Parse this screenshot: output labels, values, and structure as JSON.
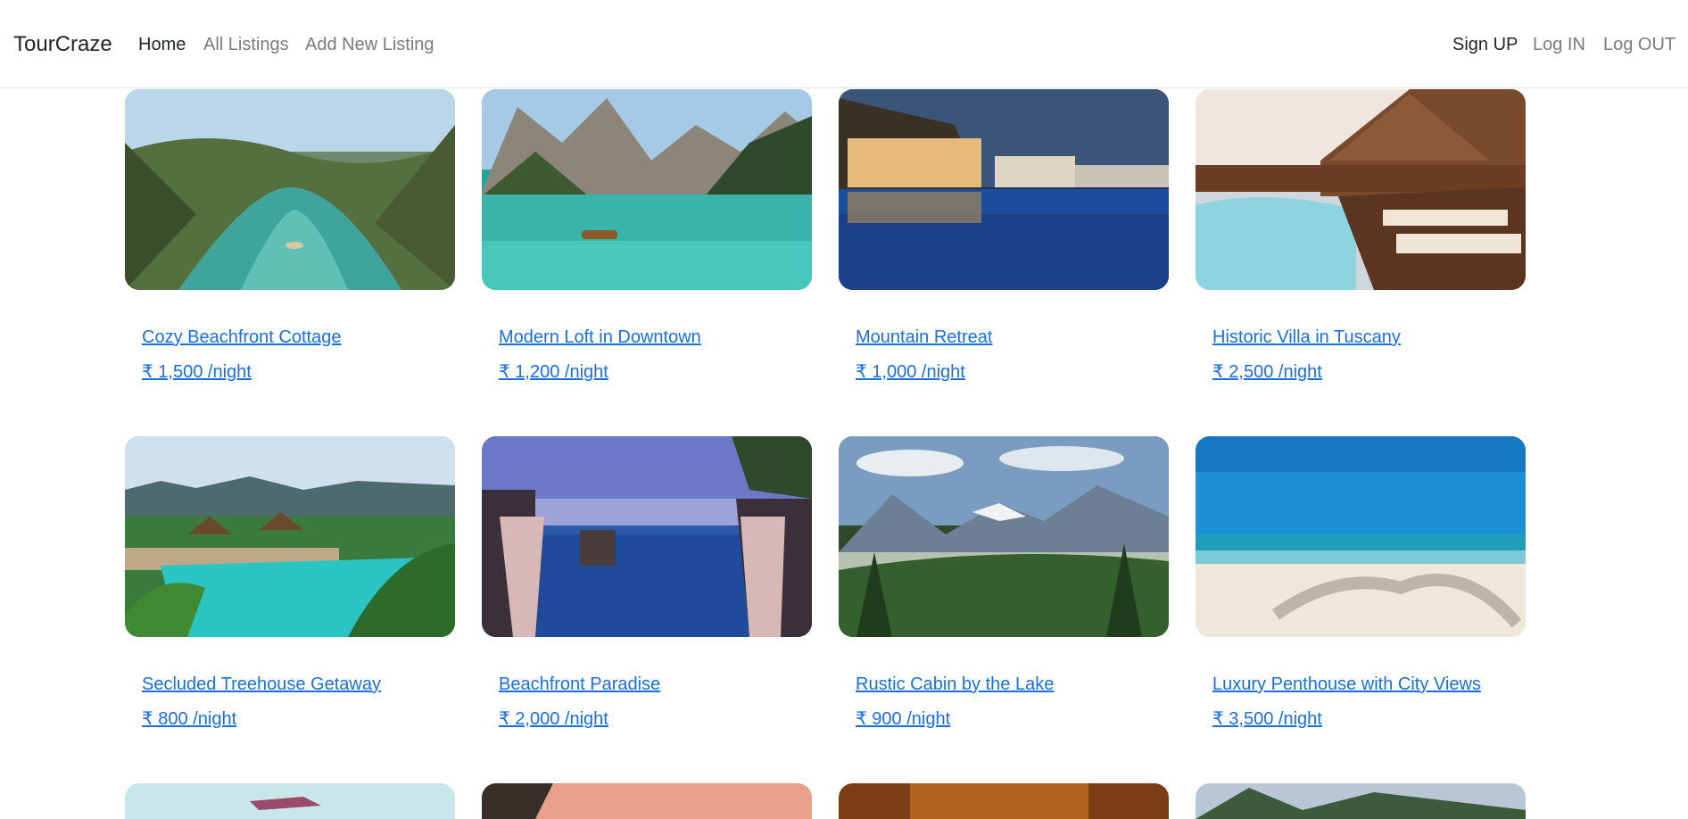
{
  "navbar": {
    "brand": "TourCraze",
    "links": [
      {
        "label": "Home",
        "active": true
      },
      {
        "label": "All Listings",
        "active": false
      },
      {
        "label": "Add New Listing",
        "active": false
      }
    ],
    "auth": [
      {
        "label": "Sign UP"
      },
      {
        "label": "Log IN"
      },
      {
        "label": "Log OUT"
      }
    ]
  },
  "listings": [
    {
      "title": "Cozy Beachfront Cottage",
      "price": "₹ 1,500 /night",
      "scene": "tropical-lagoon"
    },
    {
      "title": "Modern Loft in Downtown",
      "price": "₹ 1,200 /night",
      "scene": "mountain-lake"
    },
    {
      "title": "Mountain Retreat",
      "price": "₹ 1,000 /night",
      "scene": "resort-pool-night"
    },
    {
      "title": "Historic Villa in Tuscany",
      "price": "₹ 2,500 /night",
      "scene": "villa-pool-deck"
    },
    {
      "title": "Secluded Treehouse Getaway",
      "price": "₹ 800 /night",
      "scene": "tropical-resort-pool"
    },
    {
      "title": "Beachfront Paradise",
      "price": "₹ 2,000 /night",
      "scene": "infinity-pool-cabanas"
    },
    {
      "title": "Rustic Cabin by the Lake",
      "price": "₹ 900 /night",
      "scene": "alpine-valley"
    },
    {
      "title": "Luxury Penthouse with City Views",
      "price": "₹ 3,500 /night",
      "scene": "sandy-beach"
    }
  ],
  "colors": {
    "link": "#1a6fe0",
    "text": "#212529",
    "muted": "#7b7b7b"
  }
}
